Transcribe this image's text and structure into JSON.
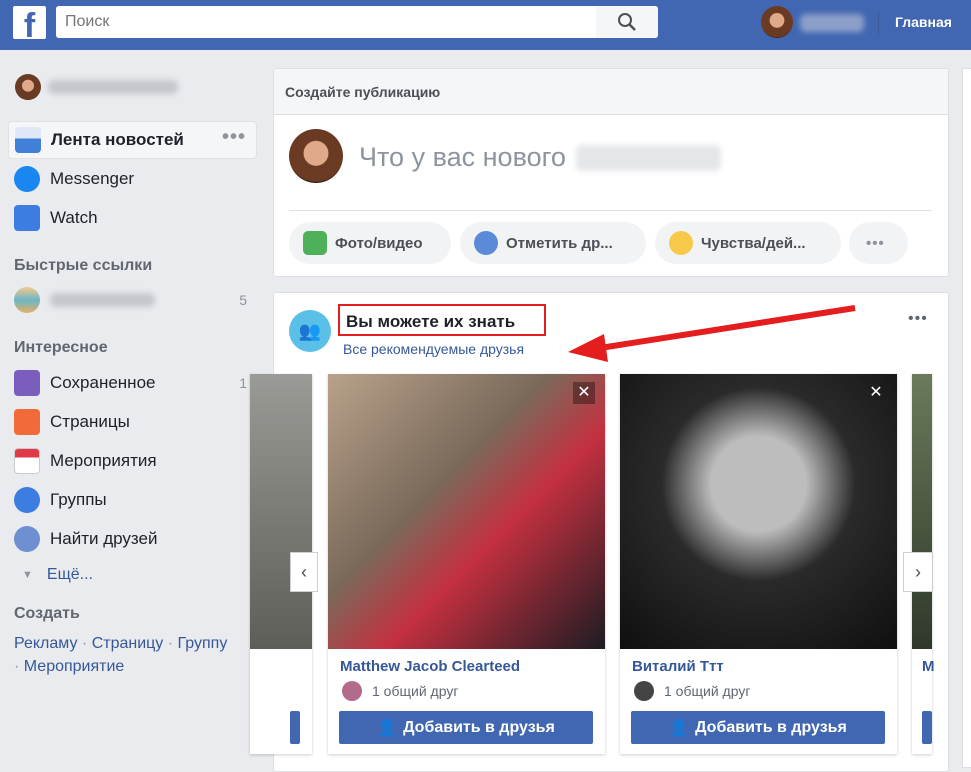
{
  "header": {
    "search_placeholder": "Поиск",
    "home": "Главная"
  },
  "sidebar": {
    "items": [
      {
        "label": "Лента новостей",
        "icon": "news-feed-icon"
      },
      {
        "label": "Messenger",
        "icon": "messenger-icon"
      },
      {
        "label": "Watch",
        "icon": "watch-icon"
      }
    ],
    "quick_links_title": "Быстрые ссылки",
    "quick_link_count": "5",
    "interesting_title": "Интересное",
    "interesting": [
      {
        "label": "Сохраненное",
        "count": "1"
      },
      {
        "label": "Страницы"
      },
      {
        "label": "Мероприятия"
      },
      {
        "label": "Группы"
      },
      {
        "label": "Найти друзей"
      }
    ],
    "more": "Ещё...",
    "create_title": "Создать",
    "create_links": [
      "Рекламу",
      "Страницу",
      "Группу",
      "Мероприятие"
    ]
  },
  "composer": {
    "title": "Создайте публикацию",
    "prompt": "Что у вас нового",
    "actions": [
      "Фото/видео",
      "Отметить др...",
      "Чувства/дей..."
    ]
  },
  "pymk": {
    "title": "Вы можете их знать",
    "link": "Все рекомендуемые друзья",
    "people": [
      {
        "name": "Matthew Jacob Clearteed",
        "mutual": "1 общий друг",
        "add": "Добавить в друзья"
      },
      {
        "name": "Виталий Ттт",
        "mutual": "1 общий друг",
        "add": "Добавить в друзья"
      }
    ],
    "annotation_color": "#e41e1e"
  }
}
